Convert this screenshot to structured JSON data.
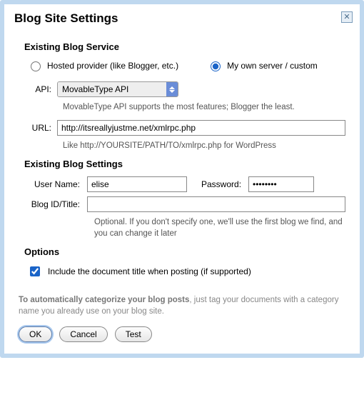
{
  "dialog": {
    "title": "Blog Site Settings"
  },
  "service": {
    "heading": "Existing Blog Service",
    "radio_hosted": "Hosted provider (like Blogger, etc.)",
    "radio_own": "My own server / custom",
    "api_label": "API:",
    "api_value": "MovableType API",
    "api_hint": "MovableType API supports the most features; Blogger the least.",
    "url_label": "URL:",
    "url_value": "http://itsreallyjustme.net/xmlrpc.php",
    "url_hint": "Like http://YOURSITE/PATH/TO/xmlrpc.php for WordPress"
  },
  "settings": {
    "heading": "Existing Blog Settings",
    "user_label": "User Name:",
    "user_value": "elise",
    "pwd_label": "Password:",
    "pwd_value": "••••••••",
    "blogid_label": "Blog ID/Title:",
    "blogid_value": "",
    "blogid_hint": "Optional. If you don't specify one, we'll use the first blog we find, and you can change it later"
  },
  "options": {
    "heading": "Options",
    "include_title": "Include the document title when posting (if supported)"
  },
  "footer": {
    "bold": "To automatically categorize your blog posts",
    "rest": ", just tag your documents with a category name you already use on your blog site."
  },
  "buttons": {
    "ok": "OK",
    "cancel": "Cancel",
    "test": "Test"
  }
}
